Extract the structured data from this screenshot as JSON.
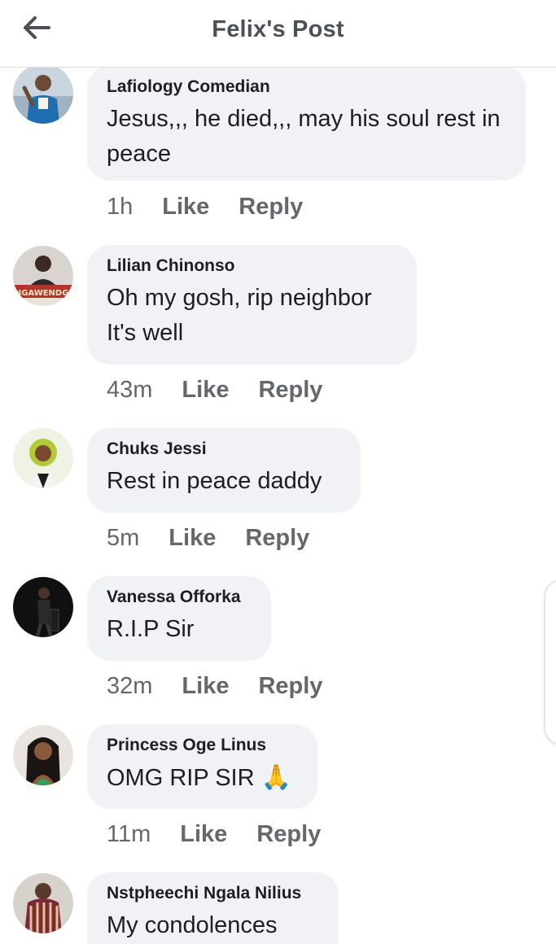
{
  "header": {
    "title": "Felix's Post"
  },
  "comments": [
    {
      "author": "Lafiology Comedian",
      "text": "Jesus,,, he died,,, may his soul rest in peace",
      "time": "1h",
      "like_label": "Like",
      "reply_label": "Reply"
    },
    {
      "author": "Lilian Chinonso",
      "text_line1": "Oh my gosh, rip neighbor",
      "text_line2": "It's well",
      "avatar_banner_text": "NGAWENDGI",
      "time": "43m",
      "like_label": "Like",
      "reply_label": "Reply"
    },
    {
      "author": "Chuks Jessi",
      "text": "Rest in peace daddy",
      "time": "5m",
      "like_label": "Like",
      "reply_label": "Reply"
    },
    {
      "author": "Vanessa Offorka",
      "text": "R.I.P Sir",
      "time": "32m",
      "like_label": "Like",
      "reply_label": "Reply"
    },
    {
      "author": "Princess Oge Linus",
      "text": "OMG RIP SIR",
      "emoji": "🙏",
      "time": "11m",
      "like_label": "Like",
      "reply_label": "Reply"
    },
    {
      "author": "Nstpheechi Ngala Nilius",
      "text": "My condolences"
    }
  ],
  "colors": {
    "bubble": "#f0f2f5",
    "author": "#1c1e21",
    "meta": "#65676b",
    "header_title": "#4b4f56"
  },
  "icons": {
    "back": "arrow-left-icon"
  }
}
